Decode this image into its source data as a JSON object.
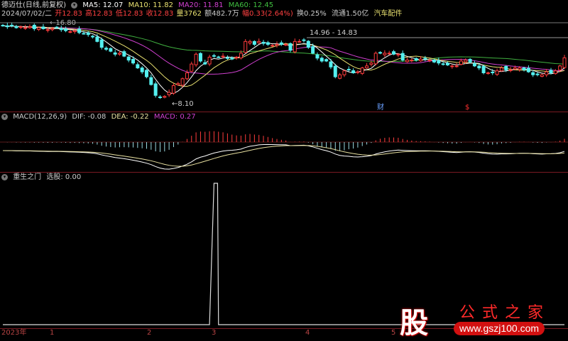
{
  "header": {
    "title": "德迈仕(日线,前复权)",
    "ma5": "MA5: 12.07",
    "ma10": "MA10: 11.82",
    "ma20": "MA20: 11.81",
    "ma60": "MA60: 12.45",
    "date": "2024/07/02/二",
    "open": "开12.83",
    "high": "高12.83",
    "low": "低12.83",
    "close": "收12.83",
    "volume": "量3762",
    "amount": "额482.7万",
    "change": "幅0.33(2.64%)",
    "turnover": "换0.25%",
    "float": "流通1.50亿",
    "sector": "汽车配件"
  },
  "main_chart": {
    "high_label": "16.80",
    "low_label": "8.10",
    "range_label": "14.96 - 14.83",
    "marker_finance": "财",
    "marker_dividend": "$"
  },
  "macd_panel": {
    "title": "MACD(12,26,9)",
    "dif": "DIF: -0.08",
    "dea": "DEA: -0.22",
    "macd": "MACD: 0.27"
  },
  "signal_panel": {
    "title": "重生之门",
    "value": "选股: 0.00"
  },
  "x_axis": [
    "2023年",
    "1",
    "2",
    "3",
    "4",
    "5"
  ],
  "watermark": {
    "logo": "股",
    "brand": "公式之家",
    "url": "www.gszj100.com"
  },
  "colors": {
    "up": "#ff3c3c",
    "down": "#54f0f0",
    "ma5": "#ffffff",
    "ma10": "#e8e070",
    "ma20": "#d040d0",
    "ma60": "#40b040"
  },
  "chart_data": {
    "type": "candlestick",
    "closes": [
      16.1,
      16.0,
      16.1,
      15.9,
      16.0,
      15.9,
      16.0,
      15.8,
      15.9,
      15.8,
      15.7,
      15.8,
      15.9,
      15.7,
      15.6,
      15.5,
      15.6,
      15.4,
      15.3,
      15.2,
      14.96,
      14.5,
      13.9,
      13.7,
      13.5,
      13.2,
      13.3,
      13.0,
      12.6,
      12.3,
      11.8,
      11.4,
      10.9,
      10.1,
      9.0,
      8.8,
      8.9,
      9.3,
      10.0,
      10.2,
      10.7,
      11.3,
      12.2,
      13.2,
      12.5,
      12.2,
      12.9,
      13.0,
      12.9,
      13.0,
      12.8,
      12.7,
      12.9,
      13.3,
      14.5,
      14.5,
      14.2,
      14.5,
      14.3,
      14.2,
      14.1,
      14.2,
      14.2,
      14.2,
      13.6,
      14.5,
      14.5,
      14.6,
      13.9,
      13.3,
      12.8,
      12.5,
      12.5,
      11.9,
      10.9,
      11.1,
      11.5,
      11.6,
      11.3,
      11.4,
      11.8,
      12.0,
      12.3,
      13.3,
      13.3,
      13.3,
      13.3,
      13.2,
      13.2,
      12.6,
      12.6,
      12.6,
      12.6,
      12.7,
      12.7,
      12.6,
      12.4,
      12.3,
      12.2,
      12.1,
      12.0,
      12.0,
      12.5,
      12.6,
      12.4,
      12.0,
      11.8,
      11.3,
      11.3,
      11.3,
      11.5,
      11.8,
      11.6,
      11.6,
      11.8,
      11.8,
      11.6,
      11.4,
      11.1,
      11.1,
      11.1,
      11.4,
      11.3,
      11.5,
      12.0,
      12.83
    ],
    "signal_index": 47,
    "signal_value": 1
  }
}
